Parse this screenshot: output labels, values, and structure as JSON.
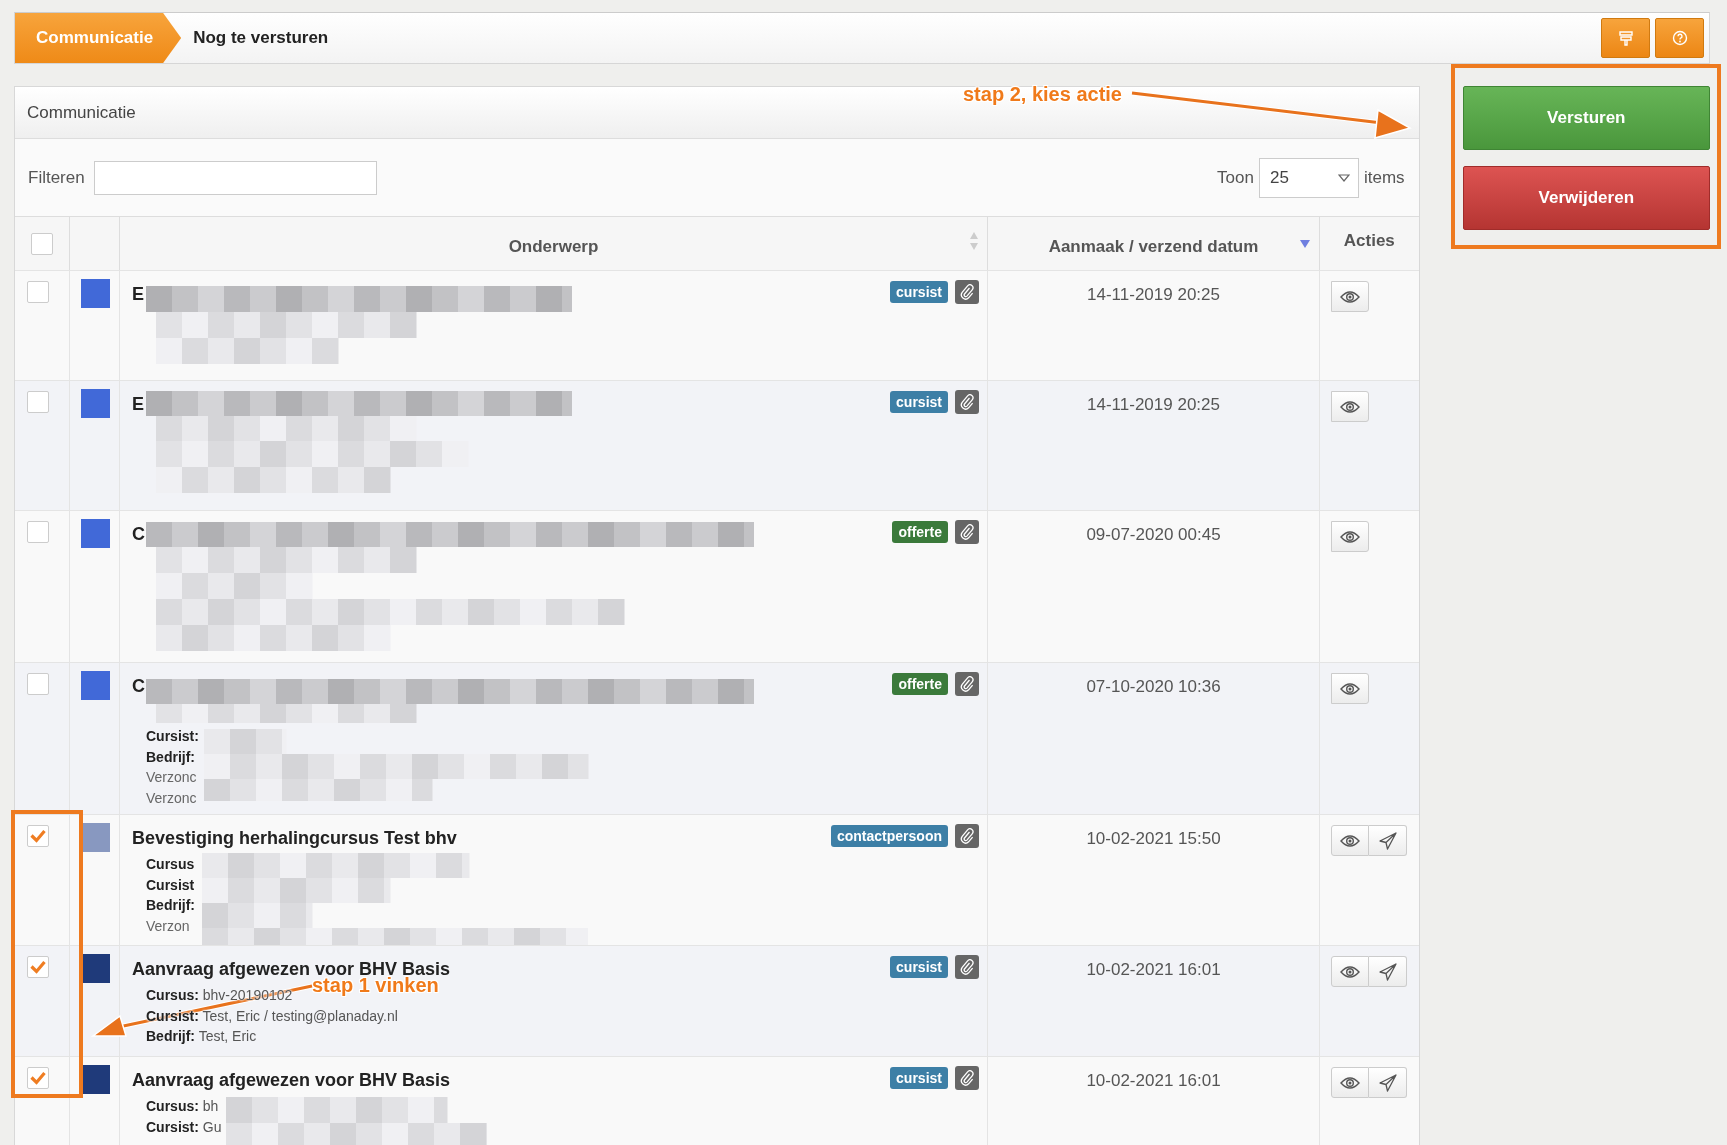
{
  "breadcrumb": [
    {
      "label": "Communicatie",
      "selected": true
    },
    {
      "label": "Nog te versturen",
      "selected": false
    }
  ],
  "toolbar_buttons": [
    {
      "kind": "filter"
    },
    {
      "kind": "help"
    }
  ],
  "panel": {
    "title": "Communicatie",
    "filter": {
      "label": "Filteren"
    },
    "page_size": {
      "label": "Toon",
      "value": "25",
      "suffix": "items"
    }
  },
  "select_all": {
    "checked": false
  },
  "columns": [
    {
      "label": "Onderwerp",
      "sortable": true
    },
    {
      "label": "Aanmaak / verzend datum",
      "sortable": true,
      "sorted_descending": true
    },
    {
      "label": "Acties",
      "sortable": false
    }
  ],
  "rows": [
    {
      "checked": false,
      "color": "#4169d8",
      "title": "E",
      "tag": {
        "label": "cursist",
        "color": "#3d7fa6"
      },
      "details": [],
      "date": "14-11-2019 20:25",
      "actions": [
        {
          "kind": "view"
        }
      ]
    },
    {
      "checked": false,
      "color": "#4169d8",
      "title": "E",
      "tag": {
        "label": "cursist",
        "color": "#3d7fa6"
      },
      "details": [],
      "date": "14-11-2019 20:25",
      "actions": [
        {
          "kind": "view"
        }
      ]
    },
    {
      "checked": false,
      "color": "#4169d8",
      "title": "C",
      "tag": {
        "label": "offerte",
        "color": "#3b7a3b"
      },
      "details": [],
      "date": "09-07-2020 00:45",
      "actions": [
        {
          "kind": "view"
        }
      ]
    },
    {
      "checked": false,
      "color": "#4169d8",
      "title": "C",
      "tag": {
        "label": "offerte",
        "color": "#3b7a3b"
      },
      "details": [
        {
          "kind": "field",
          "label": "Cursist:"
        },
        {
          "kind": "field",
          "label": "Bedrijf:"
        },
        {
          "kind": "note",
          "label": "Verzonc"
        },
        {
          "kind": "note",
          "label": "Verzonc"
        }
      ],
      "date": "07-10-2020 10:36",
      "actions": [
        {
          "kind": "view"
        }
      ]
    },
    {
      "checked": true,
      "color": "#8898c0",
      "title": "Bevestiging herhalingcursus Test bhv",
      "tag": {
        "label": "contactpersoon",
        "color": "#3d7fa6"
      },
      "details": [
        {
          "kind": "field",
          "label": "Cursus"
        },
        {
          "kind": "field",
          "label": "Cursist"
        },
        {
          "kind": "field",
          "label": "Bedrijf:"
        },
        {
          "kind": "note",
          "label": "Verzon"
        }
      ],
      "date": "10-02-2021 15:50",
      "actions": [
        {
          "kind": "view"
        },
        {
          "kind": "send"
        }
      ]
    },
    {
      "checked": true,
      "color": "#1f3a7a",
      "title": "Aanvraag afgewezen voor BHV Basis",
      "tag": {
        "label": "cursist",
        "color": "#3d7fa6"
      },
      "details": [
        {
          "kind": "field",
          "label": "Cursus:",
          "value": "bhv-20190102"
        },
        {
          "kind": "field",
          "label": "Cursist:",
          "value": "Test, Eric / testing@planaday.nl"
        },
        {
          "kind": "field",
          "label": "Bedrijf:",
          "value": "Test, Eric"
        }
      ],
      "date": "10-02-2021 16:01",
      "actions": [
        {
          "kind": "view"
        },
        {
          "kind": "send"
        }
      ]
    },
    {
      "checked": true,
      "color": "#1f3a7a",
      "title": "Aanvraag afgewezen voor BHV Basis",
      "tag": {
        "label": "cursist",
        "color": "#3d7fa6"
      },
      "details": [
        {
          "kind": "field",
          "label": "Cursus:",
          "value": "bh"
        },
        {
          "kind": "field",
          "label": "Cursist:",
          "value": "Gu"
        }
      ],
      "date": "10-02-2021 16:01",
      "actions": [
        {
          "kind": "view"
        },
        {
          "kind": "send"
        }
      ]
    }
  ],
  "side_buttons": [
    {
      "kind": "primary",
      "label": "Versturen"
    },
    {
      "kind": "danger",
      "label": "Verwijderen"
    }
  ],
  "annotations": [
    {
      "text": "stap 2, kies actie"
    },
    {
      "text": "stap 1 vinken"
    }
  ]
}
